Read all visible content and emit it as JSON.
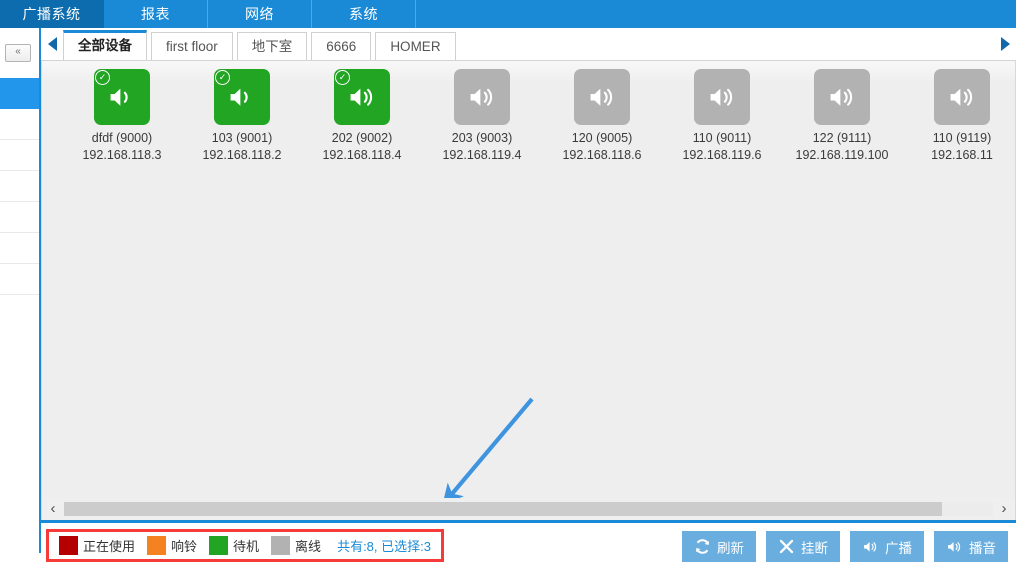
{
  "menubar": {
    "items": [
      {
        "label": "广播系统",
        "active": true
      },
      {
        "label": "报表",
        "active": false
      },
      {
        "label": "网络",
        "active": false
      },
      {
        "label": "系统",
        "active": false
      }
    ],
    "bg_color": "#1b8ad6",
    "active_bg_color": "#0d6cad"
  },
  "sidebar": {
    "collapse_label": "«",
    "selected_row_color": "#2196ea",
    "rows": [
      {
        "selected": true
      },
      {
        "selected": false
      },
      {
        "selected": false
      },
      {
        "selected": false
      },
      {
        "selected": false
      },
      {
        "selected": false
      },
      {
        "selected": false
      }
    ]
  },
  "tabstrip": {
    "scroll_left_icon": "triangle-left-icon",
    "scroll_right_icon": "triangle-right-icon",
    "tabs": [
      {
        "label": "全部设备",
        "active": true
      },
      {
        "label": "first floor",
        "active": false
      },
      {
        "label": "地下室",
        "active": false
      },
      {
        "label": "6666",
        "active": false
      },
      {
        "label": "HOMER",
        "active": false
      }
    ]
  },
  "devices": [
    {
      "name": "dfdf (9000)",
      "ip": "192.168.118.3",
      "status": "standby",
      "selected": true
    },
    {
      "name": "103 (9001)",
      "ip": "192.168.118.2",
      "status": "standby",
      "selected": true
    },
    {
      "name": "202 (9002)",
      "ip": "192.168.118.4",
      "status": "standby",
      "selected": true
    },
    {
      "name": "203 (9003)",
      "ip": "192.168.119.4",
      "status": "offline",
      "selected": false
    },
    {
      "name": "120 (9005)",
      "ip": "192.168.118.6",
      "status": "offline",
      "selected": false
    },
    {
      "name": "110 (9011)",
      "ip": "192.168.119.6",
      "status": "offline",
      "selected": false
    },
    {
      "name": "122 (9111)",
      "ip": "192.168.119.100",
      "status": "offline",
      "selected": false
    },
    {
      "name": "110 (9119)",
      "ip": "192.168.11",
      "status": "offline",
      "selected": false
    }
  ],
  "scrollbar": {
    "left_icon": "‹",
    "right_icon": "›"
  },
  "legend": {
    "items": [
      {
        "label": "正在使用",
        "color": "#b40000"
      },
      {
        "label": "响铃",
        "color": "#f58220"
      },
      {
        "label": "待机",
        "color": "#22a522"
      },
      {
        "label": "离线",
        "color": "#b2b2b2"
      }
    ],
    "count_text": "共有:8, 已选择:3",
    "count_color": "#1b8ad6",
    "highlight_color": "#f73b3b"
  },
  "actions": [
    {
      "label": "刷新",
      "icon": "refresh-icon"
    },
    {
      "label": "挂断",
      "icon": "hangup-x-icon"
    },
    {
      "label": "广播",
      "icon": "speaker-icon"
    },
    {
      "label": "播音",
      "icon": "speaker-icon"
    }
  ],
  "annotation": {
    "arrow_color": "#3f94e0"
  }
}
